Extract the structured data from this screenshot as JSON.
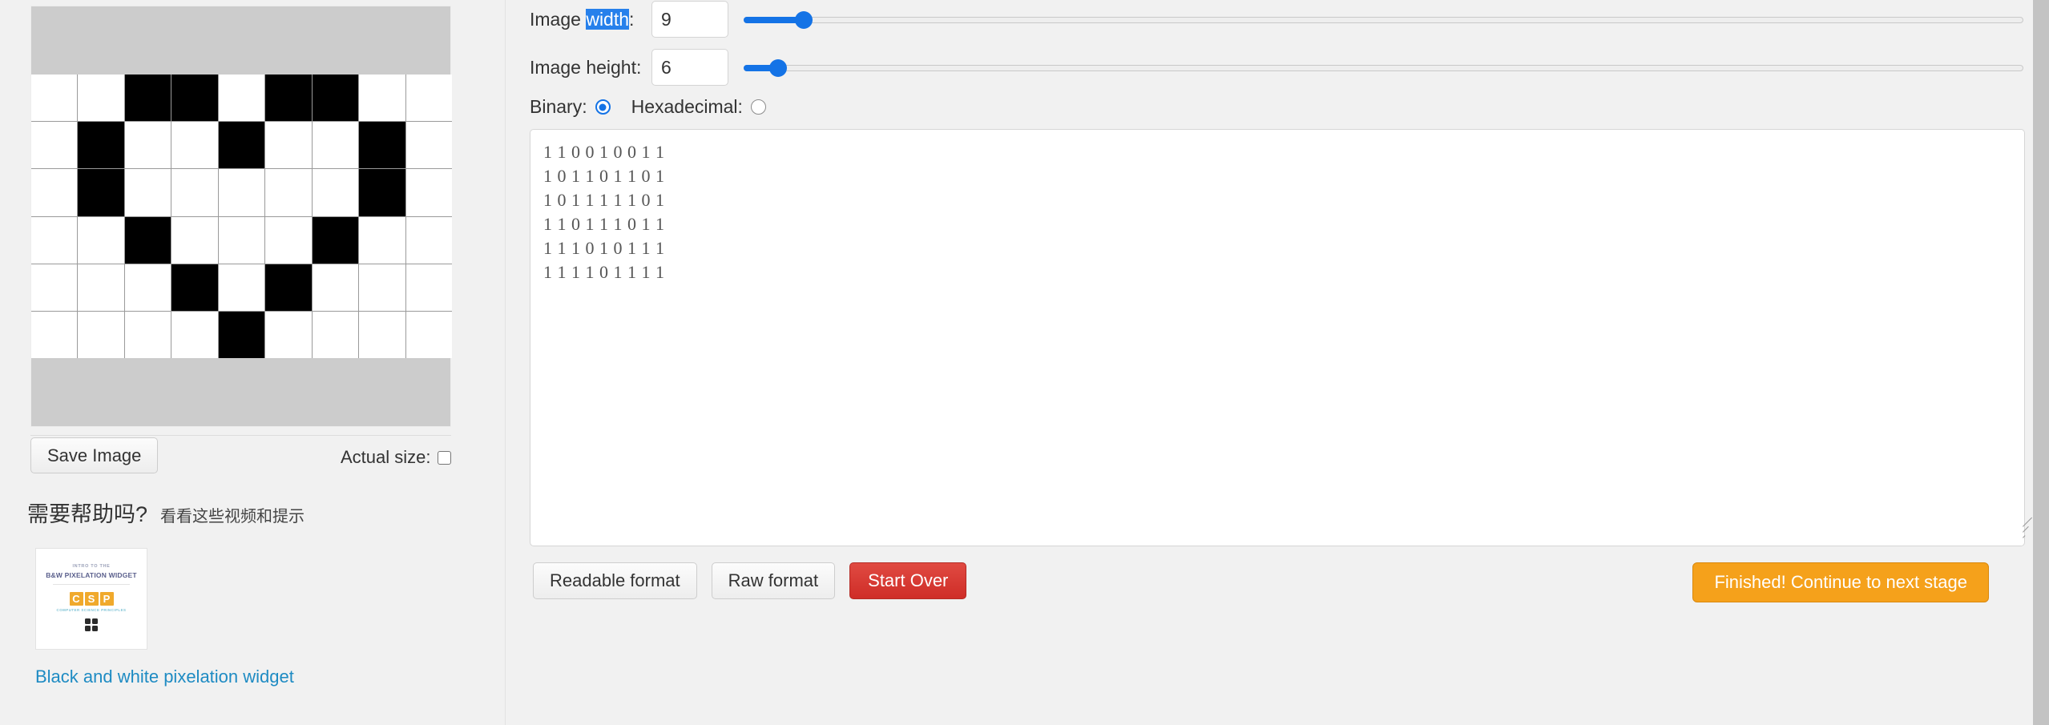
{
  "left": {
    "save_image_label": "Save Image",
    "actual_size_label": "Actual size:",
    "actual_size_checked": false,
    "help_title": "需要帮助吗?",
    "help_subtitle": "看看这些视频和提示",
    "thumbnail": {
      "intro_line": "INTRO TO THE",
      "headline": "B&W PIXELATION WIDGET",
      "logo_letters": [
        "C",
        "S",
        "P"
      ],
      "logo_subtitle": "COMPUTER SCIENCE PRINCIPLES",
      "logo_color": "#f0a92c"
    },
    "thumbnail_link": "Black and white pixelation widget",
    "link_color": "#1e8bc3"
  },
  "controls": {
    "width_label_prefix": "Image ",
    "width_label_selected": "width",
    "width_label_suffix": ":",
    "width_value": "9",
    "height_label": "Image height:",
    "height_value": "6",
    "width_slider_percent": 4,
    "height_slider_percent": 2,
    "selection_color": "#2680eb",
    "slider_color": "#1473e6"
  },
  "format": {
    "binary_label": "Binary:",
    "hexadecimal_label": "Hexadecimal:",
    "binary_selected": true,
    "hexadecimal_selected": false
  },
  "binary_text": "1 1 0 0 1 0 0 1 1\n1 0 1 1 0 1 1 0 1\n1 0 1 1 1 1 1 0 1\n1 1 0 1 1 1 0 1 1\n1 1 1 0 1 0 1 1 1\n1 1 1 1 0 1 1 1 1",
  "pixel_grid": {
    "width": 9,
    "height": 6,
    "rows": [
      [
        1,
        1,
        0,
        0,
        1,
        0,
        0,
        1,
        1
      ],
      [
        1,
        0,
        1,
        1,
        0,
        1,
        1,
        0,
        1
      ],
      [
        1,
        0,
        1,
        1,
        1,
        1,
        1,
        0,
        1
      ],
      [
        1,
        1,
        0,
        1,
        1,
        1,
        0,
        1,
        1
      ],
      [
        1,
        1,
        1,
        0,
        1,
        0,
        1,
        1,
        1
      ],
      [
        1,
        1,
        1,
        1,
        0,
        1,
        1,
        1,
        1
      ]
    ]
  },
  "buttons": {
    "readable_format": "Readable format",
    "raw_format": "Raw format",
    "start_over": "Start Over",
    "finished": "Finished! Continue to next stage",
    "start_over_color": "#cf2d27",
    "finished_color": "#f5a11b"
  }
}
